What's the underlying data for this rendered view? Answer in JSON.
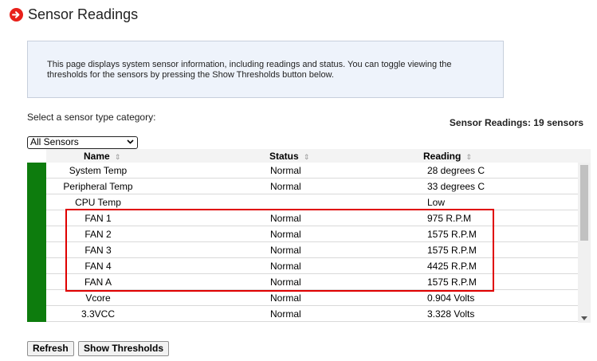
{
  "page": {
    "title": "Sensor Readings",
    "info_text": "This page displays system sensor information, including readings and status. You can toggle viewing the thresholds for the sensors by pressing the Show Thresholds button below.",
    "select_label": "Select a sensor type category:",
    "count_label": "Sensor Readings: 19 sensors",
    "select_value": "All Sensors",
    "icons": {
      "title": "arrow-right-circle-icon",
      "sort": "sort-arrows-icon",
      "dropdown": "chevron-down-icon"
    },
    "colors": {
      "status_ok": "#0d7c0d",
      "title_icon": "#e8201a",
      "highlight": "#e00000"
    }
  },
  "table": {
    "headers": {
      "name": "Name",
      "status": "Status",
      "reading": "Reading"
    },
    "rows": [
      {
        "name": "System Temp",
        "status": "Normal",
        "reading": "28 degrees C"
      },
      {
        "name": "Peripheral Temp",
        "status": "Normal",
        "reading": "33 degrees C"
      },
      {
        "name": "CPU Temp",
        "status": "",
        "reading": "Low"
      },
      {
        "name": "FAN 1",
        "status": "Normal",
        "reading": "975 R.P.M"
      },
      {
        "name": "FAN 2",
        "status": "Normal",
        "reading": "1575 R.P.M"
      },
      {
        "name": "FAN 3",
        "status": "Normal",
        "reading": "1575 R.P.M"
      },
      {
        "name": "FAN 4",
        "status": "Normal",
        "reading": "4425 R.P.M"
      },
      {
        "name": "FAN A",
        "status": "Normal",
        "reading": "1575 R.P.M"
      },
      {
        "name": "Vcore",
        "status": "Normal",
        "reading": "0.904 Volts"
      },
      {
        "name": "3.3VCC",
        "status": "Normal",
        "reading": "3.328 Volts"
      }
    ]
  },
  "buttons": {
    "refresh": "Refresh",
    "show_thresholds": "Show Thresholds"
  }
}
